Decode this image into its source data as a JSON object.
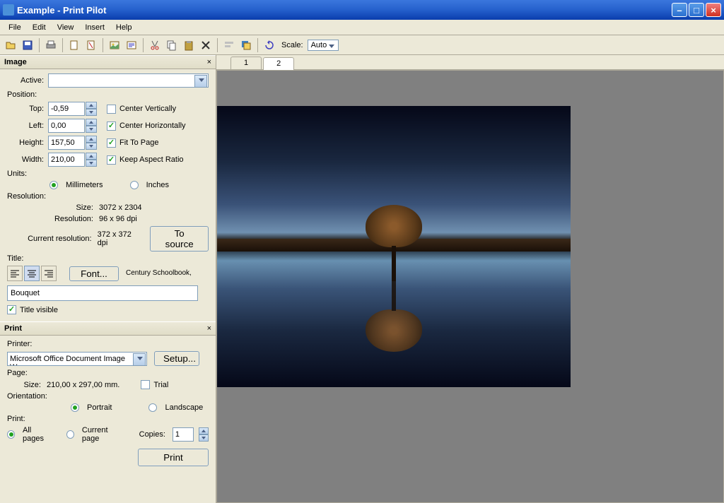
{
  "window": {
    "title": "Example - Print Pilot"
  },
  "menu": {
    "file": "File",
    "edit": "Edit",
    "view": "View",
    "insert": "Insert",
    "help": "Help"
  },
  "toolbar": {
    "scale_label": "Scale:",
    "scale_value": "Auto"
  },
  "tabs": {
    "t1": "1",
    "t2": "2"
  },
  "image_panel": {
    "title": "Image",
    "active_label": "Active:",
    "position_label": "Position:",
    "top_label": "Top:",
    "top_value": "-0,59",
    "left_label": "Left:",
    "left_value": "0,00",
    "height_label": "Height:",
    "height_value": "157,50",
    "width_label": "Width:",
    "width_value": "210,00",
    "center_v": "Center Vertically",
    "center_h": "Center Horizontally",
    "fit": "Fit To Page",
    "keep_ar": "Keep Aspect Ratio",
    "units_label": "Units:",
    "mm": "Millimeters",
    "in": "Inches",
    "resolution_label": "Resolution:",
    "size_label": "Size:",
    "size_value": "3072 x 2304",
    "res_label": "Resolution:",
    "res_value": "96 x 96 dpi",
    "curres_label": "Current resolution:",
    "curres_value": "372 x 372 dpi",
    "to_source": "To source",
    "title_section": "Title:",
    "font_btn": "Font...",
    "font_name": "Century Schoolbook,",
    "title_value": "Bouquet",
    "title_visible": "Title visible"
  },
  "print_panel": {
    "title": "Print",
    "printer_label": "Printer:",
    "printer_value": "Microsoft Office Document Image W",
    "setup": "Setup...",
    "page_label": "Page:",
    "size_label": "Size:",
    "size_value": "210,00 x 297,00 mm.",
    "trial": "Trial",
    "orientation_label": "Orientation:",
    "portrait": "Portrait",
    "landscape": "Landscape",
    "print_label": "Print:",
    "all_pages": "All pages",
    "current_page": "Current page",
    "copies_label": "Copies:",
    "copies_value": "1",
    "print_btn": "Print"
  }
}
